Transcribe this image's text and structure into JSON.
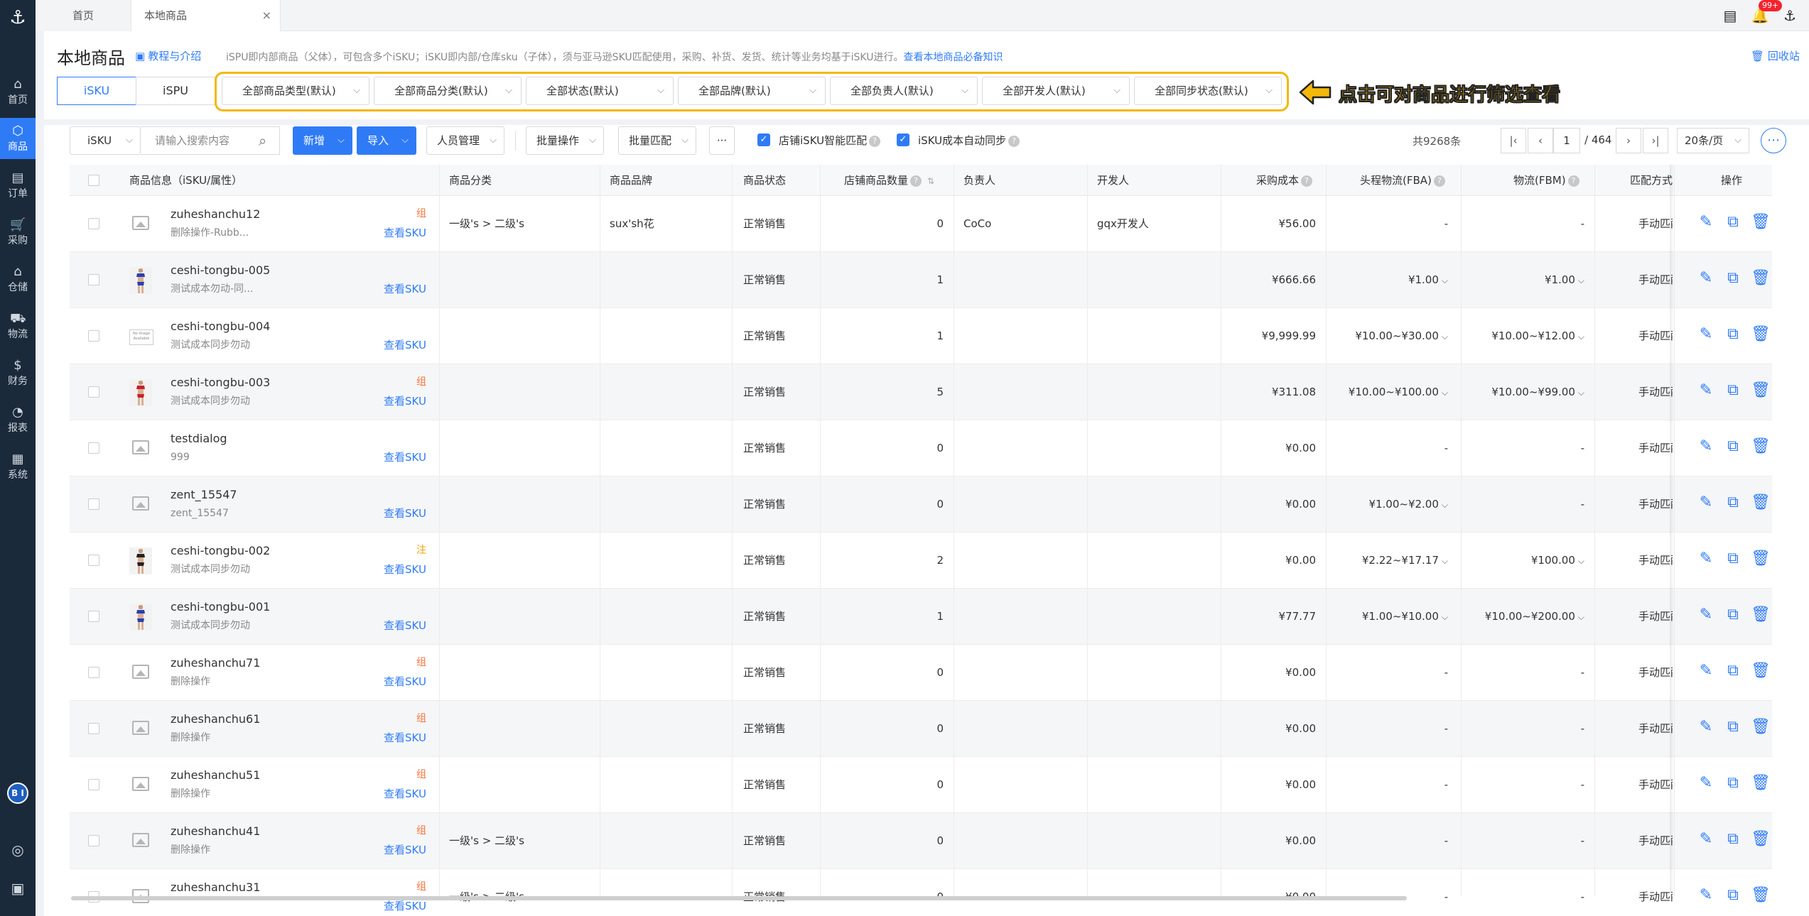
{
  "nav": {
    "items": [
      {
        "label": "首页",
        "icon": "home-icon",
        "glyph": "⌂"
      },
      {
        "label": "商品",
        "icon": "product-cube-icon",
        "glyph": "⬡"
      },
      {
        "label": "订单",
        "icon": "order-doc-icon",
        "glyph": "▤"
      },
      {
        "label": "采购",
        "icon": "cart-icon",
        "glyph": "🛒"
      },
      {
        "label": "仓储",
        "icon": "warehouse-icon",
        "glyph": "⌂"
      },
      {
        "label": "物流",
        "icon": "truck-icon",
        "glyph": "⛟"
      },
      {
        "label": "财务",
        "icon": "money-icon",
        "glyph": "$"
      },
      {
        "label": "报表",
        "icon": "chart-icon",
        "glyph": "◔"
      },
      {
        "label": "系统",
        "icon": "system-icon",
        "glyph": "▦"
      }
    ],
    "avatar_text": "B I"
  },
  "tabs": {
    "home": "首页",
    "current": "本地商品",
    "notification_count": "99+"
  },
  "header": {
    "title": "本地商品",
    "tutorial": "教程与介绍",
    "description": "iSPU即内部商品（父体），可包含多个iSKU；iSKU即内部/仓库sku（子体），须与亚马逊SKU匹配使用，采购、补货、发货、统计等业务均基于iSKU进行。",
    "knowledge_link": "查看本地商品必备知识",
    "recycle": "回收站"
  },
  "mode_tabs": [
    "iSKU",
    "iSPU"
  ],
  "filters": [
    "全部商品类型(默认)",
    "全部商品分类(默认)",
    "全部状态(默认)",
    "全部品牌(默认)",
    "全部负责人(默认)",
    "全部开发人(默认)",
    "全部同步状态(默认)"
  ],
  "annotation": "点击可对商品进行筛选查看",
  "toolbar": {
    "search_type": "iSKU",
    "search_placeholder": "请输入搜索内容",
    "add": "新增",
    "import": "导入",
    "personnel": "人员管理",
    "batch_ops": "批量操作",
    "batch_match": "批量匹配",
    "more": "···",
    "smart_match": "店铺iSKU智能匹配",
    "cost_sync": "iSKU成本自动同步"
  },
  "pagination": {
    "total": "共9268条",
    "current": "1",
    "pages": "/ 464",
    "page_size": "20条/页"
  },
  "table": {
    "headers": {
      "info": "商品信息（iSKU/属性）",
      "category": "商品分类",
      "brand": "商品品牌",
      "status": "商品状态",
      "store_qty": "店铺商品数量",
      "owner": "负责人",
      "developer": "开发人",
      "cost": "采购成本",
      "fba": "头程物流(FBA)",
      "fbm": "物流(FBM)",
      "match": "匹配方式",
      "ops": "操作"
    },
    "view_sku": "查看SKU",
    "rows": [
      {
        "name": "zuheshanchu12",
        "attr": "删除操作-Rubb...",
        "tag": "组",
        "tagType": "zu",
        "img": "placeholder",
        "category": "一级's > 二级's",
        "brand": "sux'sh花",
        "status": "正常销售",
        "qty": "0",
        "owner": "CoCo",
        "developer": "gqx开发人",
        "cost": "¥56.00",
        "fba": "-",
        "fba_dd": false,
        "fbm": "-",
        "fbm_dd": false,
        "match": "手动匹配"
      },
      {
        "name": "ceshi-tongbu-005",
        "attr": "测试成本勿动-同...",
        "tag": "",
        "tagType": "",
        "img": "bikini-blue",
        "category": "",
        "brand": "",
        "status": "正常销售",
        "qty": "1",
        "owner": "",
        "developer": "",
        "cost": "¥666.66",
        "fba": "¥1.00",
        "fba_dd": true,
        "fbm": "¥1.00",
        "fbm_dd": true,
        "match": "手动匹配"
      },
      {
        "name": "ceshi-tongbu-004",
        "attr": "测试成本同步勿动",
        "tag": "",
        "tagType": "",
        "img": "no-image",
        "category": "",
        "brand": "",
        "status": "正常销售",
        "qty": "1",
        "owner": "",
        "developer": "",
        "cost": "¥9,999.99",
        "fba": "¥10.00~¥30.00",
        "fba_dd": true,
        "fbm": "¥10.00~¥12.00",
        "fbm_dd": true,
        "match": "手动匹配"
      },
      {
        "name": "ceshi-tongbu-003",
        "attr": "测试成本同步勿动",
        "tag": "组",
        "tagType": "zu",
        "img": "bikini-red",
        "category": "",
        "brand": "",
        "status": "正常销售",
        "qty": "5",
        "owner": "",
        "developer": "",
        "cost": "¥311.08",
        "fba": "¥10.00~¥100.00",
        "fba_dd": true,
        "fbm": "¥10.00~¥99.00",
        "fbm_dd": true,
        "match": "手动匹配"
      },
      {
        "name": "testdialog",
        "attr": "999",
        "tag": "",
        "tagType": "",
        "img": "placeholder",
        "category": "",
        "brand": "",
        "status": "正常销售",
        "qty": "0",
        "owner": "",
        "developer": "",
        "cost": "¥0.00",
        "fba": "-",
        "fba_dd": false,
        "fbm": "-",
        "fbm_dd": false,
        "match": "手动匹配"
      },
      {
        "name": "zent_15547",
        "attr": "zent_15547",
        "tag": "",
        "tagType": "",
        "img": "placeholder",
        "category": "",
        "brand": "",
        "status": "正常销售",
        "qty": "0",
        "owner": "",
        "developer": "",
        "cost": "¥0.00",
        "fba": "¥1.00~¥2.00",
        "fba_dd": true,
        "fbm": "-",
        "fbm_dd": false,
        "match": "手动匹配"
      },
      {
        "name": "ceshi-tongbu-002",
        "attr": "测试成本同步勿动",
        "tag": "注",
        "tagType": "zhu",
        "img": "bikini-black",
        "category": "",
        "brand": "",
        "status": "正常销售",
        "qty": "2",
        "owner": "",
        "developer": "",
        "cost": "¥0.00",
        "fba": "¥2.22~¥17.17",
        "fba_dd": true,
        "fbm": "¥100.00",
        "fbm_dd": true,
        "match": "手动匹配"
      },
      {
        "name": "ceshi-tongbu-001",
        "attr": "测试成本同步勿动",
        "tag": "",
        "tagType": "",
        "img": "bikini-blue",
        "category": "",
        "brand": "",
        "status": "正常销售",
        "qty": "1",
        "owner": "",
        "developer": "",
        "cost": "¥77.77",
        "fba": "¥1.00~¥10.00",
        "fba_dd": true,
        "fbm": "¥10.00~¥200.00",
        "fbm_dd": true,
        "match": "手动匹配"
      },
      {
        "name": "zuheshanchu71",
        "attr": "删除操作",
        "tag": "组",
        "tagType": "zu",
        "img": "placeholder",
        "category": "",
        "brand": "",
        "status": "正常销售",
        "qty": "0",
        "owner": "",
        "developer": "",
        "cost": "¥0.00",
        "fba": "-",
        "fba_dd": false,
        "fbm": "-",
        "fbm_dd": false,
        "match": "手动匹配"
      },
      {
        "name": "zuheshanchu61",
        "attr": "删除操作",
        "tag": "组",
        "tagType": "zu",
        "img": "placeholder",
        "category": "",
        "brand": "",
        "status": "正常销售",
        "qty": "0",
        "owner": "",
        "developer": "",
        "cost": "¥0.00",
        "fba": "-",
        "fba_dd": false,
        "fbm": "-",
        "fbm_dd": false,
        "match": "手动匹配"
      },
      {
        "name": "zuheshanchu51",
        "attr": "删除操作",
        "tag": "组",
        "tagType": "zu",
        "img": "placeholder",
        "category": "",
        "brand": "",
        "status": "正常销售",
        "qty": "0",
        "owner": "",
        "developer": "",
        "cost": "¥0.00",
        "fba": "-",
        "fba_dd": false,
        "fbm": "-",
        "fbm_dd": false,
        "match": "手动匹配"
      },
      {
        "name": "zuheshanchu41",
        "attr": "删除操作",
        "tag": "组",
        "tagType": "zu",
        "img": "placeholder",
        "category": "一级's > 二级's",
        "brand": "",
        "status": "正常销售",
        "qty": "0",
        "owner": "",
        "developer": "",
        "cost": "¥0.00",
        "fba": "-",
        "fba_dd": false,
        "fbm": "-",
        "fbm_dd": false,
        "match": "手动匹配"
      },
      {
        "name": "zuheshanchu31",
        "attr": "",
        "tag": "组",
        "tagType": "zu",
        "img": "placeholder",
        "category": "一级's > 二级's",
        "brand": "",
        "status": "正常销售",
        "qty": "0",
        "owner": "",
        "developer": "",
        "cost": "¥0.00",
        "fba": "-",
        "fba_dd": false,
        "fbm": "-",
        "fbm_dd": false,
        "match": "手动匹配"
      }
    ]
  },
  "colors": {
    "accent": "#2f7bf6",
    "highlight": "#f3b80a",
    "nav_bg": "#1b2a3a",
    "tag_group": "#f5733b"
  }
}
